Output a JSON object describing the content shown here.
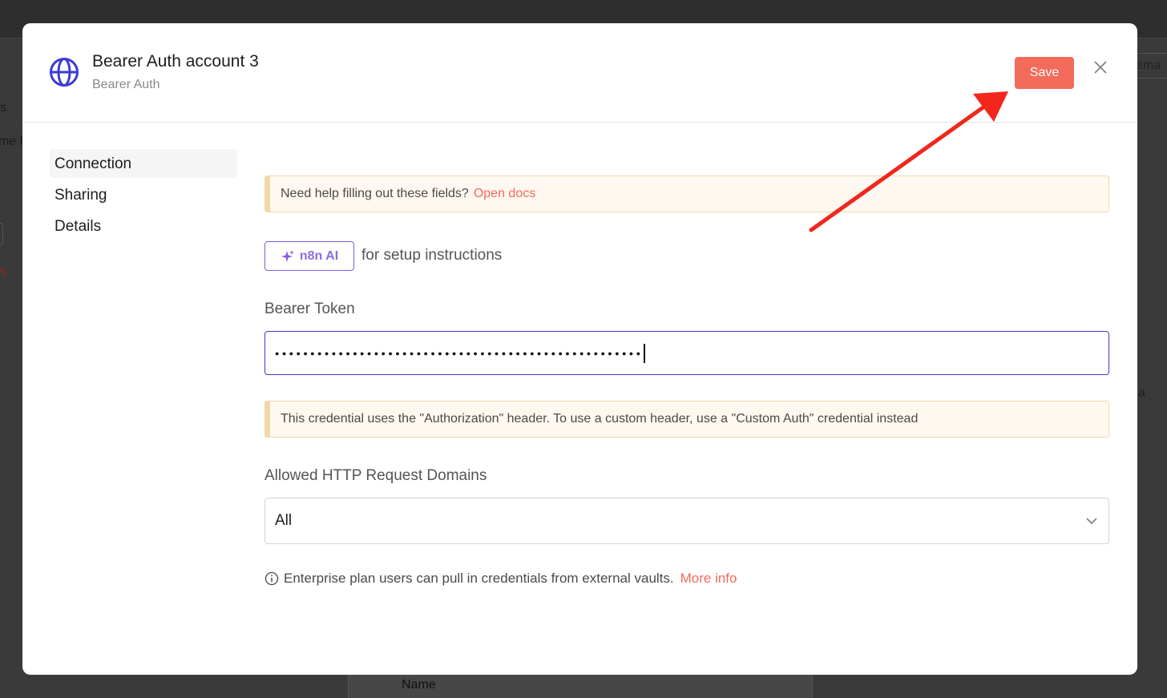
{
  "backdrop": {
    "frag_s": "s",
    "frag_me": "me f",
    "frag_right_tab": "ema",
    "frag_a": "a",
    "name_header": "Name"
  },
  "modal": {
    "title": "Bearer Auth account 3",
    "subtitle": "Bearer Auth",
    "save_label": "Save",
    "icons": {
      "credential": "globe-icon",
      "close": "close-icon"
    }
  },
  "sidebar": {
    "items": [
      {
        "label": "Connection",
        "active": true
      },
      {
        "label": "Sharing",
        "active": false
      },
      {
        "label": "Details",
        "active": false
      }
    ]
  },
  "help_callout": {
    "text": "Need help filling out these fields?",
    "link": "Open docs"
  },
  "ai": {
    "button_label": "n8n AI",
    "suffix": "for setup instructions"
  },
  "bearer_token": {
    "label": "Bearer Token",
    "value": "●●●●●●●●●●●●●●●●●●●●●●●●●●●●●●●●●●●●●●●●●●●●●●●●●●●●"
  },
  "header_callout": {
    "text": "This credential uses the \"Authorization\" header. To use a custom header, use a \"Custom Auth\" credential instead"
  },
  "domains": {
    "label": "Allowed HTTP Request Domains",
    "selected": "All"
  },
  "enterprise_note": {
    "text": "Enterprise plan users can pull in credentials from external vaults.",
    "link": "More info"
  },
  "colors": {
    "accent": "#f26b5b",
    "input_focus": "#4338ca",
    "ai_purple": "#7b5cd6",
    "annotation_arrow": "#f2261a"
  }
}
